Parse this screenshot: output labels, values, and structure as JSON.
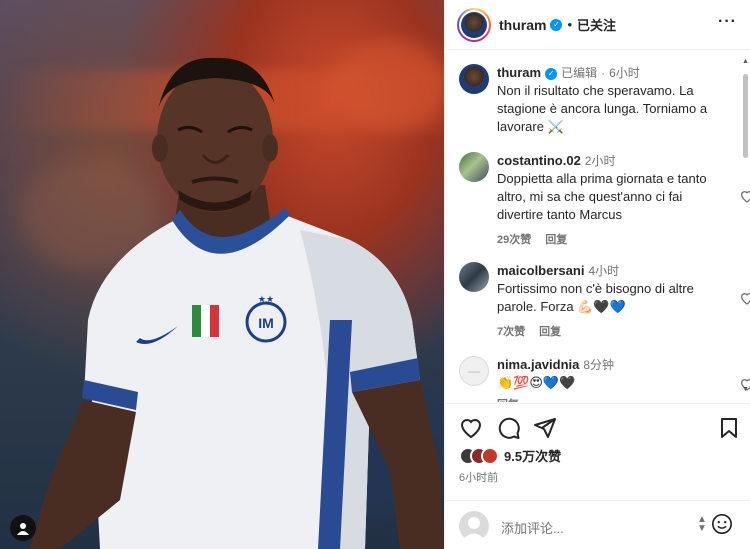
{
  "post": {
    "author": "thuram",
    "dot": "•",
    "follow_label": "已关注",
    "more_icon": "more-horizontal-icon"
  },
  "caption": {
    "username": "thuram",
    "edited": "已编辑",
    "dot": "·",
    "time": "6小时",
    "text": "Non il risultato che speravamo. La stagione è ancora lunga. Torniamo a lavorare ⚔️"
  },
  "comments": [
    {
      "username": "costantino.02",
      "time": "2小时",
      "text": "Doppietta alla prima giornata e tanto altro, mi sa che quest'anno ci fai divertire tanto Marcus",
      "likes": "29次赞",
      "reply": "回复"
    },
    {
      "username": "maicolbersani",
      "time": "4小时",
      "text": "Fortissimo non c'è bisogno di altre parole. Forza 💪🏻🖤💙",
      "likes": "7次赞",
      "reply": "回复"
    },
    {
      "username": "nima.javidnia",
      "time": "8分钟",
      "text": "👏💯😍💙🖤",
      "likes": "",
      "reply": "回复"
    }
  ],
  "actions": {
    "like_icon": "heart-icon",
    "comment_icon": "comment-icon",
    "share_icon": "send-icon",
    "save_icon": "bookmark-icon"
  },
  "likes_summary": "9.5万次赞",
  "post_time": "6小时前",
  "add_comment": {
    "placeholder": "添加评论..."
  },
  "colors": {
    "verified": "#0095f6",
    "secondary_text": "#737373"
  }
}
